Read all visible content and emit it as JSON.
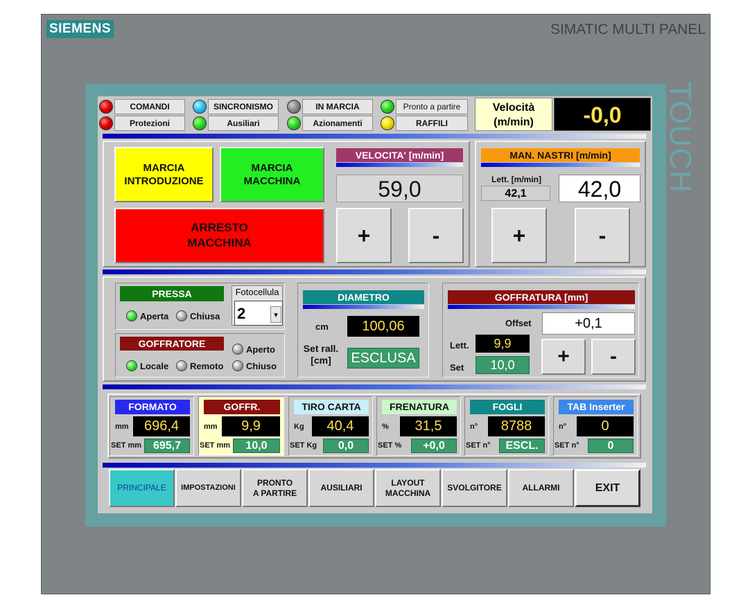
{
  "device": {
    "brand": "SIEMENS",
    "model": "SIMATIC MULTI PANEL",
    "touch": "TOUCH"
  },
  "status": {
    "comandi": "COMANDI",
    "protezioni": "Protezioni",
    "sincronismo": "SINCRONISMO",
    "ausiliari": "Ausiliari",
    "in_marcia": "IN MARCIA",
    "azionamenti": "Azionamenti",
    "pronto": "Pronto a partire",
    "raffili": "RAFFILI"
  },
  "speed": {
    "label_line1": "Velocità",
    "label_line2": "(m/min)",
    "value": "-0,0"
  },
  "controls": {
    "marcia_intro_l1": "MARCIA",
    "marcia_intro_l2": "INTRODUZIONE",
    "marcia_macchina_l1": "MARCIA",
    "marcia_macchina_l2": "MACCHINA",
    "arresto_l1": "ARRESTO",
    "arresto_l2": "MACCHINA"
  },
  "velocita": {
    "header": "VELOCITA' [m/min]",
    "value": "59,0",
    "plus": "+",
    "minus": "-"
  },
  "nastri": {
    "header": "MAN. NASTRI [m/min]",
    "lett_label": "Lett. [m/min]",
    "lett_value": "42,1",
    "value": "42,0",
    "plus": "+",
    "minus": "-"
  },
  "pressa": {
    "header": "PRESSA",
    "aperta": "Aperta",
    "chiusa": "Chiusa"
  },
  "fotocellula": {
    "label": "Fotocellula",
    "value": "2",
    "arrow": "▾"
  },
  "goffratore": {
    "header": "GOFFRATORE",
    "aperto": "Aperto",
    "locale": "Locale",
    "remoto": "Remoto",
    "chiuso": "Chiuso"
  },
  "diametro": {
    "header": "DIAMETRO",
    "cm_label": "cm",
    "cm_value": "100,06",
    "set_label_l1": "Set rall.",
    "set_label_l2": "[cm]",
    "set_value": "ESCLUSA"
  },
  "goffratura": {
    "header": "GOFFRATURA [mm]",
    "offset_label": "Offset",
    "offset_value": "+0,1",
    "lett_label": "Lett.",
    "lett_value": "9,9",
    "set_label": "Set",
    "set_value": "10,0",
    "plus": "+",
    "minus": "-"
  },
  "bottom_boxes": [
    {
      "header": "FORMATO",
      "unit": "mm",
      "value": "696,4",
      "set_label": "SET mm",
      "set_value": "695,7",
      "color": "#2828f0"
    },
    {
      "header": "GOFFR.",
      "unit": "mm",
      "value": "9,9",
      "set_label": "SET mm",
      "set_value": "10,0",
      "color": "#8a1010"
    },
    {
      "header": "TIRO CARTA",
      "unit": "Kg",
      "value": "40,4",
      "set_label": "SET Kg",
      "set_value": "0,0",
      "color": "#c8eef8"
    },
    {
      "header": "FRENATURA",
      "unit": "%",
      "value": "31,5",
      "set_label": "SET %",
      "set_value": "+0,0",
      "color": "#c8f8c8"
    },
    {
      "header": "FOGLI",
      "unit": "n°",
      "value": "8788",
      "set_label": "SET n°",
      "set_value": "ESCL.",
      "color": "#108888"
    },
    {
      "header": "TAB Inserter",
      "unit": "n°",
      "value": "0",
      "set_label": "SET n°",
      "set_value": "0",
      "color": "#3a88e8"
    }
  ],
  "nav": {
    "principale": "PRINCIPALE",
    "impostazioni": "IMPOSTAZIONI",
    "pronto_l1": "PRONTO",
    "pronto_l2": "A PARTIRE",
    "ausiliari": "AUSILIARI",
    "layout_l1": "LAYOUT",
    "layout_l2": "MACCHINA",
    "svolgitore": "SVOLGITORE",
    "allarmi": "ALLARMI",
    "exit": "EXIT"
  },
  "colors": {
    "screen": "#c8c8c8",
    "frame": "#66a0a2",
    "bezel": "#7f8486",
    "active_nav": "#38c8c8"
  }
}
